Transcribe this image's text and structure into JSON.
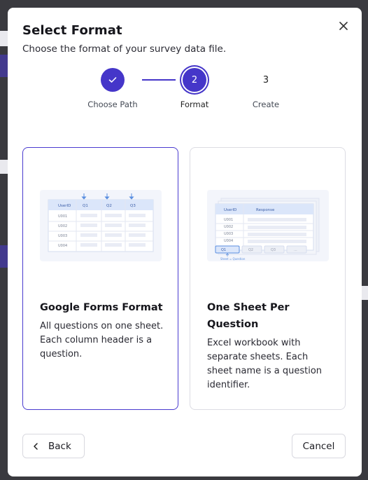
{
  "dialog": {
    "title": "Select Format",
    "subtitle": "Choose the format of your survey data file.",
    "close_icon": "close-icon"
  },
  "stepper": {
    "steps": [
      {
        "label": "Choose Path",
        "state": "done",
        "number": ""
      },
      {
        "label": "Format",
        "state": "active",
        "number": "2"
      },
      {
        "label": "Create",
        "state": "pending",
        "number": "3"
      }
    ]
  },
  "cards": [
    {
      "title": "Google Forms Format",
      "description": "All questions on one sheet. Each column header is a question.",
      "selected": true,
      "illustration": {
        "headers": [
          "UserID",
          "Q1",
          "Q2",
          "Q3"
        ],
        "rows": [
          "U001",
          "U002",
          "U003",
          "U004"
        ]
      }
    },
    {
      "title": "One Sheet Per Question",
      "description": "Excel workbook with separate sheets. Each sheet name is a question identifier.",
      "selected": false,
      "illustration": {
        "headers": [
          "UserID",
          "Response"
        ],
        "rows": [
          "U001",
          "U002",
          "U003",
          "U004"
        ],
        "tabs": [
          "Q1",
          "Q2",
          "Q3",
          "..."
        ],
        "caption": "Sheet = Question"
      }
    }
  ],
  "footer": {
    "back_label": "Back",
    "cancel_label": "Cancel"
  },
  "colors": {
    "accent": "#4536c9",
    "card_border_selected": "#4a3bcf"
  }
}
